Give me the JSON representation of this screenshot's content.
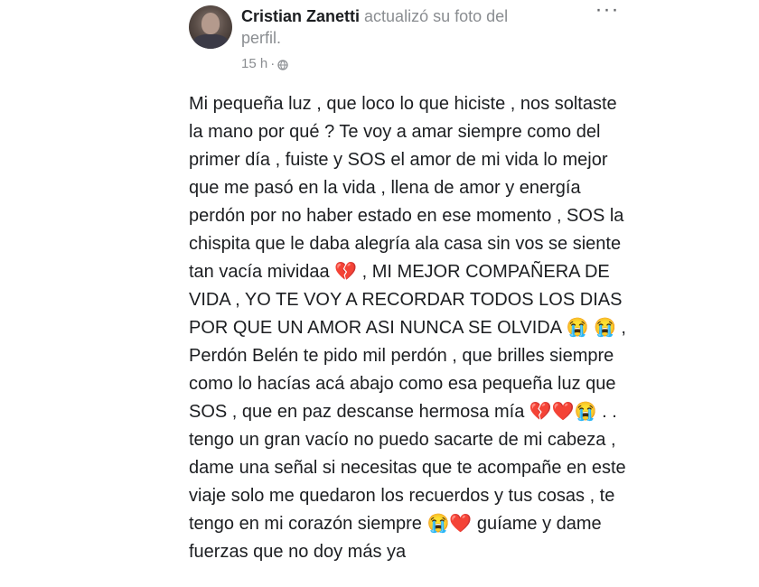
{
  "post": {
    "author": "Cristian Zanetti",
    "action": " actualizó su foto del perfil.",
    "time": "15 h",
    "separator": "·",
    "more_label": "···",
    "body": "Mi pequeña luz , que loco lo que hiciste , nos soltaste la mano por qué ? Te voy a amar siempre como del primer día , fuiste y SOS el amor de mi vida lo mejor que me pasó en la vida , llena de amor y energía perdón por no haber estado en ese momento ,  SOS la chispita que le daba alegría ala casa sin vos se siente tan vacía mividaa 💔 , MI MEJOR COMPAÑERA DE VIDA , YO TE VOY A RECORDAR TODOS LOS DIAS POR QUE UN AMOR ASI NUNCA SE OLVIDA 😭 😭 , Perdón Belén te pido mil perdón , que brilles siempre como lo hacías acá abajo como esa pequeña luz que SOS , que en paz descanse hermosa mía 💔❤️😭 . . tengo un gran vacío no puedo sacarte de mi cabeza , dame una señal si necesitas que te acompañe en este viaje solo me quedaron los recuerdos y tus cosas , te tengo en mi corazón siempre 😭❤️ guíame y dame fuerzas que no doy más ya",
    "icons": {
      "avatar": "profile-photo",
      "privacy": "globe-icon",
      "more": "more-options-icon"
    },
    "colors": {
      "name": "#1c1e21",
      "secondary": "#8a8d91",
      "text": "#1c1e21"
    }
  }
}
